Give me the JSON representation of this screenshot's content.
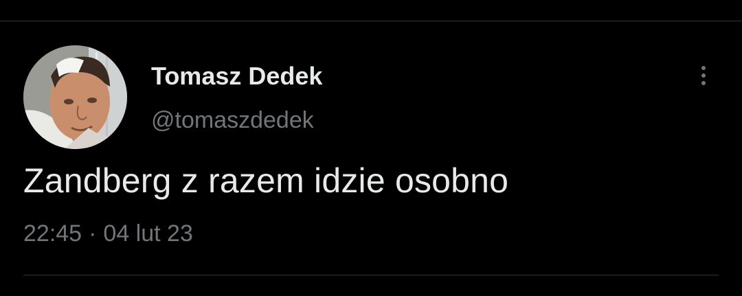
{
  "author": {
    "display_name": "Tomasz Dedek",
    "handle": "@tomaszdedek"
  },
  "tweet": {
    "text": "Zandberg z razem idzie osobno",
    "time": "22:45",
    "separator": "·",
    "date": "04 lut 23"
  },
  "icons": {
    "more": "more-vertical-icon"
  },
  "colors": {
    "background": "#000000",
    "primary_text": "#e7e9ea",
    "secondary_text": "#71767b",
    "divider": "#2f3336"
  }
}
